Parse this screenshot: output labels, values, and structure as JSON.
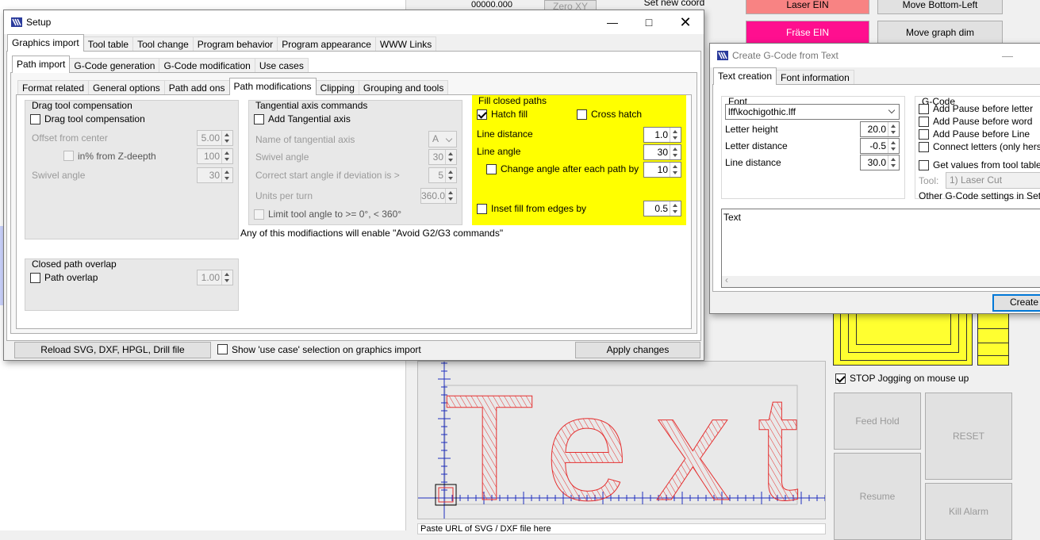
{
  "background": {
    "coord_value": "00000.000",
    "zero_xy": "Zero XY",
    "set_new_coord": "Set new coord",
    "laser_ein": "Laser EIN",
    "fraese_ein": "Fräse EIN",
    "move_bottom_left": "Move Bottom-Left",
    "move_graph_dim": "Move graph dim",
    "stop_jogging": "STOP Jogging on mouse up",
    "feed_hold": "Feed Hold",
    "reset": "RESET",
    "resume": "Resume",
    "kill_alarm": "Kill Alarm",
    "status_text": "Paste URL of SVG / DXF file here",
    "canvas_text": "Text",
    "colors": {
      "laser_btn": "#f88383",
      "fraese_btn": "#ff0f8f",
      "yellow": "#ffff30"
    }
  },
  "setup": {
    "title": "Setup",
    "main_tabs": [
      "Graphics import",
      "Tool table",
      "Tool change",
      "Program behavior",
      "Program appearance",
      "WWW Links"
    ],
    "sub_tabs": [
      "Path import",
      "G-Code generation",
      "G-Code modification",
      "Use cases"
    ],
    "sub_tabs2": [
      "Format related",
      "General options",
      "Path add ons",
      "Path modifications",
      "Clipping",
      "Grouping and tools"
    ],
    "drag": {
      "title": "Drag tool compensation",
      "check": "Drag tool compensation",
      "offset_label": "Offset from center",
      "offset_value": "5.00",
      "percent_label": "in% from Z-deepth",
      "percent_value": "100",
      "swivel_label": "Swivel angle",
      "swivel_value": "30"
    },
    "tangential": {
      "title": "Tangential axis commands",
      "check": "Add Tangential axis",
      "name_label": "Name of tangential axis",
      "name_value": "A",
      "swivel_label": "Swivel angle",
      "swivel_value": "30",
      "correct_label": "Correct start angle if deviation is >",
      "correct_value": "5",
      "units_label": "Units per turn",
      "units_value": "360.0",
      "limit_label": "Limit tool angle to >= 0°, < 360°"
    },
    "fill": {
      "title": "Fill closed paths",
      "hatch": "Hatch fill",
      "cross": "Cross hatch",
      "line_distance_label": "Line distance",
      "line_distance_value": "1.0",
      "line_angle_label": "Line angle",
      "line_angle_value": "30",
      "change_angle_label": "Change angle after each path by",
      "change_angle_value": "10",
      "inset_label": "Inset fill from edges by",
      "inset_value": "0.5"
    },
    "note": "Any of this modifiactions will enable \"Avoid G2/G3 commands\"",
    "overlap": {
      "title": "Closed path overlap",
      "check": "Path overlap",
      "value": "1.00"
    },
    "reload_btn": "Reload SVG, DXF, HPGL, Drill file",
    "show_usecase": "Show 'use case' selection on graphics import",
    "apply_btn": "Apply changes"
  },
  "gcode": {
    "title": "Create G-Code from Text",
    "tabs": [
      "Text creation",
      "Font information"
    ],
    "font_title": "Font",
    "font_value": "lff\\kochigothic.lff",
    "letter_height_label": "Letter height",
    "letter_height_value": "20.0",
    "letter_distance_label": "Letter distance",
    "letter_distance_value": "-0.5",
    "line_distance_label": "Line distance",
    "line_distance_value": "30.0",
    "gc_title": "G-Code",
    "pause_letter": "Add Pause before letter",
    "pause_word": "Add Pause before word",
    "pause_line": "Add Pause before Line",
    "connect": "Connect letters (only hershey)",
    "get_values": "Get values from tool table",
    "tool_label": "Tool:",
    "tool_value": "1) Laser Cut",
    "other": "Other G-Code settings in Setup S",
    "text_value": "Text",
    "create_btn": "Create G"
  }
}
